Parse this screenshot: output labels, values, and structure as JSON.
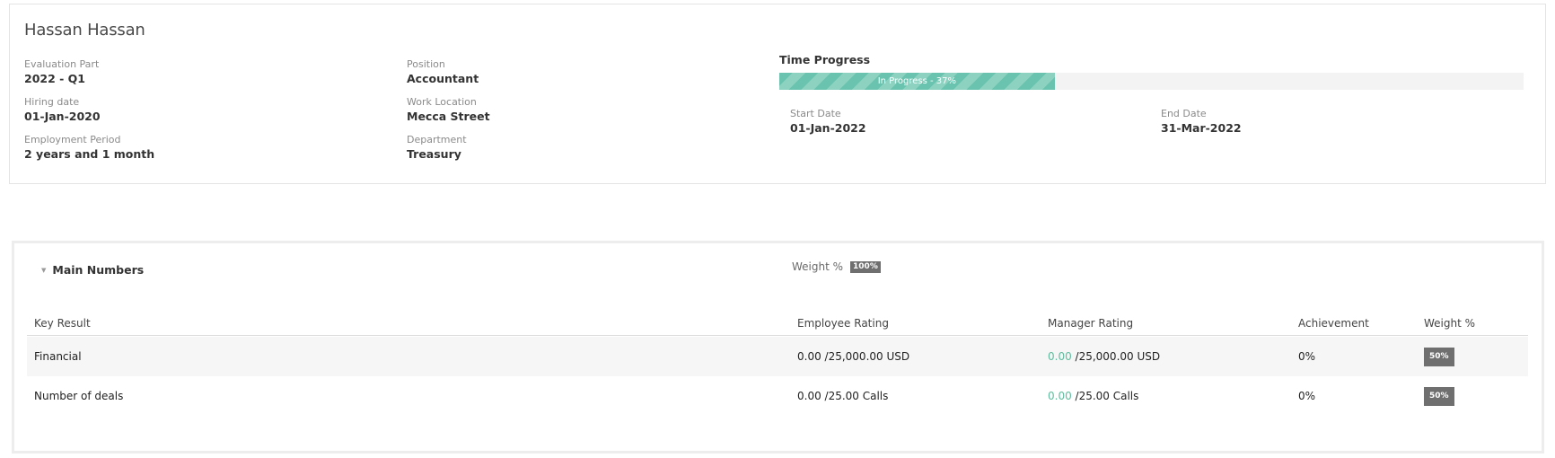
{
  "employee": {
    "name": "Hassan Hassan",
    "fields": [
      {
        "label": "Evaluation Part",
        "value": "2022 - Q1"
      },
      {
        "label": "Hiring date",
        "value": "01-Jan-2020"
      },
      {
        "label": "Employment Period",
        "value": "2 years and 1 month"
      },
      {
        "label": "Position",
        "value": "Accountant"
      },
      {
        "label": "Work Location",
        "value": "Mecca Street"
      },
      {
        "label": "Department",
        "value": "Treasury"
      }
    ]
  },
  "time_progress": {
    "title": "Time Progress",
    "progress_text": "In Progress - 37%",
    "progress_percent": 37,
    "start_label": "Start Date",
    "start_value": "01-Jan-2022",
    "end_label": "End Date",
    "end_value": "31-Mar-2022",
    "colors": {
      "fill": "#69c3ae",
      "stripe": "#8dd2c1",
      "track": "#f3f3f3"
    }
  },
  "section": {
    "title": "Main Numbers",
    "weight_label": "Weight %",
    "weight_badge": "100%",
    "columns": [
      "Key Result",
      "Employee Rating",
      "Manager Rating",
      "Achievement",
      "Weight %"
    ],
    "rows": [
      {
        "key_result": "Financial",
        "employee_rating": "0.00 /25,000.00 USD",
        "manager_value": "0.00",
        "manager_rest": " /25,000.00 USD",
        "achievement": "0%",
        "weight": "50%"
      },
      {
        "key_result": "Number of deals",
        "employee_rating": "0.00 /25.00 Calls",
        "manager_value": "0.00",
        "manager_rest": " /25.00 Calls",
        "achievement": "0%",
        "weight": "50%"
      }
    ]
  },
  "icons": {
    "section_caret": "caret-down-icon"
  },
  "colors": {
    "accent_green": "#5fbb9e",
    "badge_gray": "#6f6f6f"
  }
}
